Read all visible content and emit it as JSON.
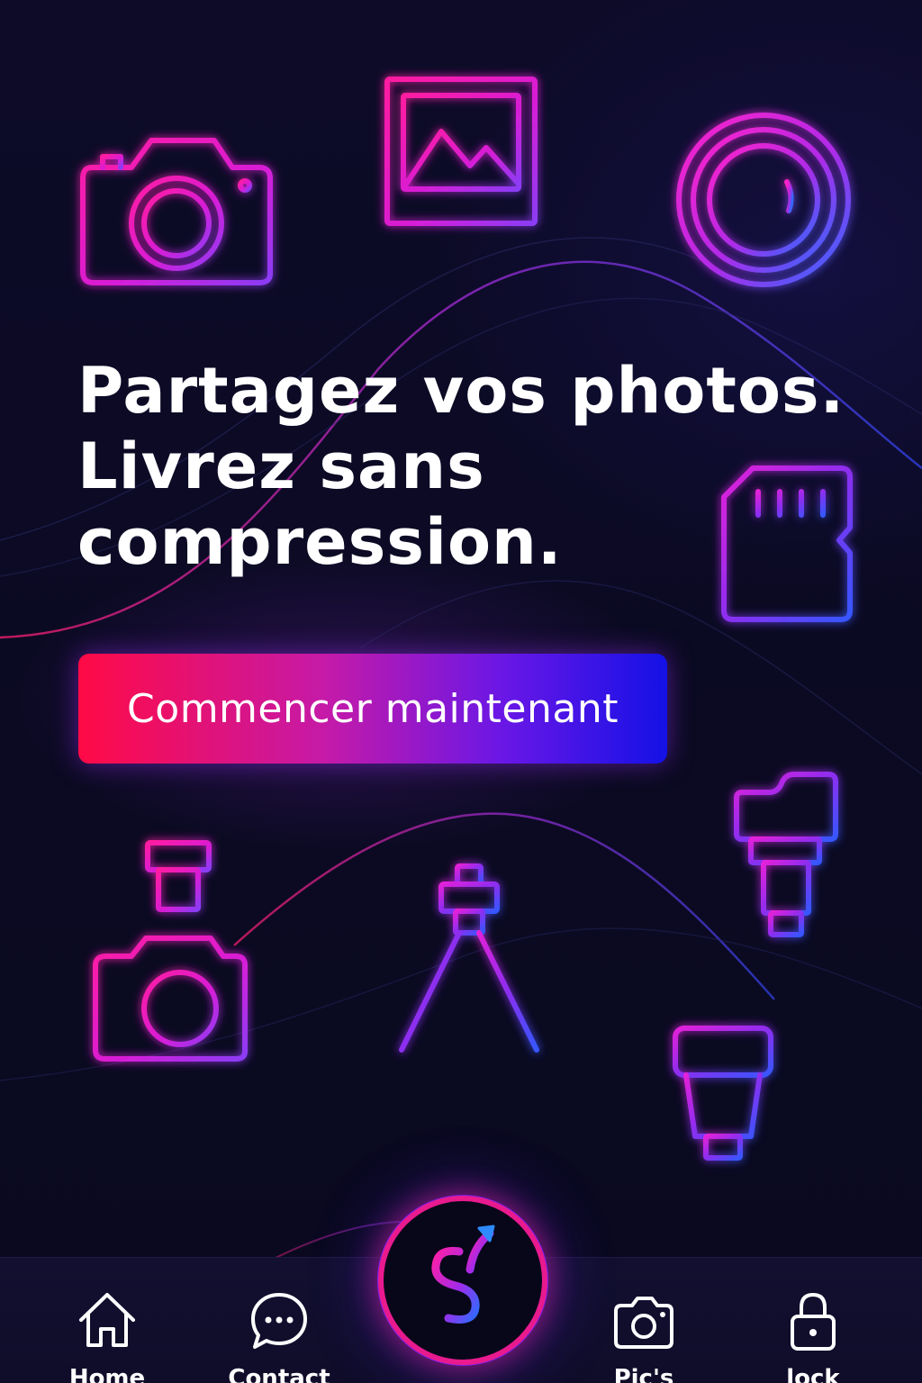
{
  "hero": {
    "headline_lines": [
      "Partagez vos photos.",
      "Livrez sans",
      "compression."
    ]
  },
  "cta": {
    "label": "Commencer maintenant"
  },
  "icons": [
    "camera-icon",
    "picture-frame-icon",
    "lens-icon",
    "sd-card-icon",
    "camera-flash-icon",
    "tripod-icon",
    "telephoto-lens-icon",
    "speedlight-flash-icon"
  ],
  "tabbar": {
    "tabs": [
      {
        "label": "Home",
        "icon": "home-icon"
      },
      {
        "label": "Contact",
        "icon": "chat-icon"
      },
      {
        "label": "Pic's",
        "icon": "camera-icon"
      },
      {
        "label": "lock",
        "icon": "lock-icon"
      }
    ],
    "center_button": {
      "icon": "s-arrow-logo-icon"
    }
  },
  "colors": {
    "background": "#0b0a24",
    "neon_pink": "#ff1fa8",
    "neon_magenta": "#d51fd8",
    "neon_purple": "#8a2cf5",
    "neon_blue": "#2a5cff",
    "cta_start": "#ff0a46",
    "cta_end": "#1411e6",
    "text": "#ffffff"
  }
}
